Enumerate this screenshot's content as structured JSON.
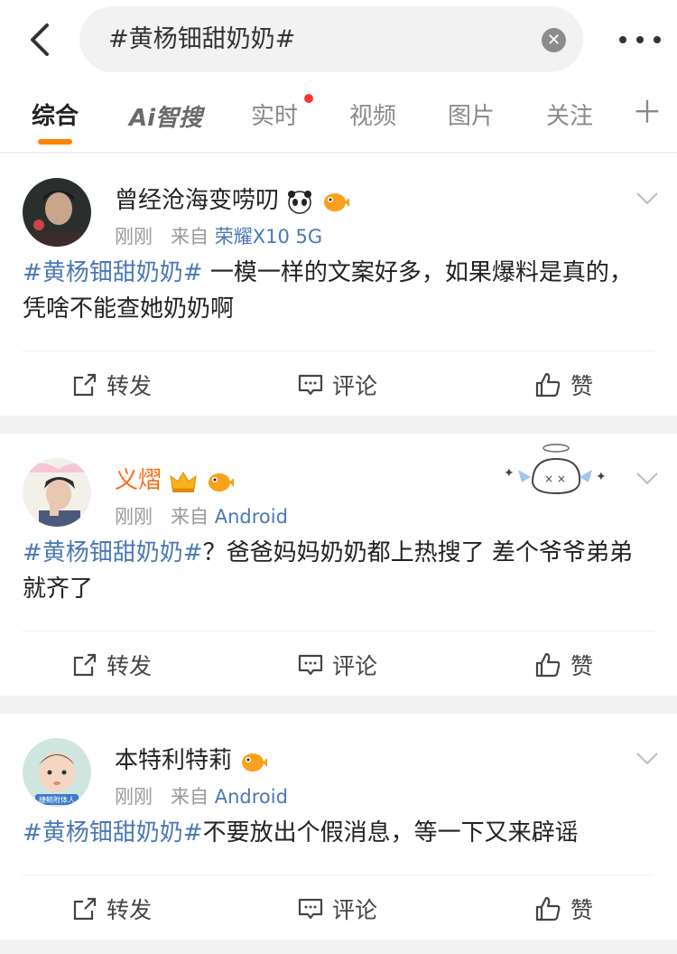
{
  "search": {
    "query": "#黄杨钿甜奶奶#"
  },
  "tabs": [
    {
      "label": "综合"
    },
    {
      "label": "Ai智搜"
    },
    {
      "label": "实时"
    },
    {
      "label": "视频"
    },
    {
      "label": "图片"
    },
    {
      "label": "关注"
    }
  ],
  "posts": [
    {
      "username": "曾经沧海变唠叨",
      "time": "刚刚",
      "source_prefix": "来自",
      "source": "荣耀X10 5G",
      "hashtag": "#黄杨钿甜奶奶#",
      "text": " 一模一样的文案好多，如果爆料是真的，凭啥不能查她奶奶啊",
      "actions": {
        "repost": "转发",
        "comment": "评论",
        "like": "赞"
      }
    },
    {
      "username": "义熠",
      "time": "刚刚",
      "source_prefix": "来自",
      "source": "Android",
      "hashtag": "#黄杨钿甜奶奶#",
      "text": "？爸爸妈妈奶奶都上热搜了 差个爷爷弟弟就齐了",
      "actions": {
        "repost": "转发",
        "comment": "评论",
        "like": "赞"
      }
    },
    {
      "username": "本特利特莉",
      "time": "刚刚",
      "source_prefix": "来自",
      "source": "Android",
      "hashtag": "#黄杨钿甜奶奶#",
      "text": "不要放出个假消息，等一下又来辟谣",
      "avatar_caption": "捷鲢附体人",
      "actions": {
        "repost": "转发",
        "comment": "评论",
        "like": "赞"
      }
    }
  ],
  "colors": {
    "accent": "#ff8200",
    "link": "#4a78b5",
    "vip_name": "#f86d15"
  }
}
